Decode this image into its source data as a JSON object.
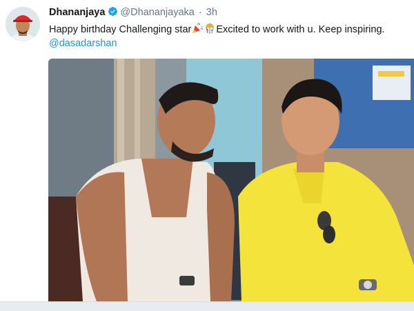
{
  "tweet": {
    "display_name": "Dhananjaya",
    "handle": "@Dhananjayaka",
    "separator": "·",
    "time": "3h",
    "text_part1": "Happy birthday Challenging star",
    "text_part2": "Excited to work with u. Keep inspiring.",
    "mention": "@dasadarshan"
  },
  "colors": {
    "link": "#1b95e0",
    "verified": "#1da1f2",
    "muted": "#657786"
  },
  "icons": {
    "verified": "verified-badge-icon",
    "emoji1": "party-popper-icon",
    "emoji2": "confetti-ball-icon"
  }
}
